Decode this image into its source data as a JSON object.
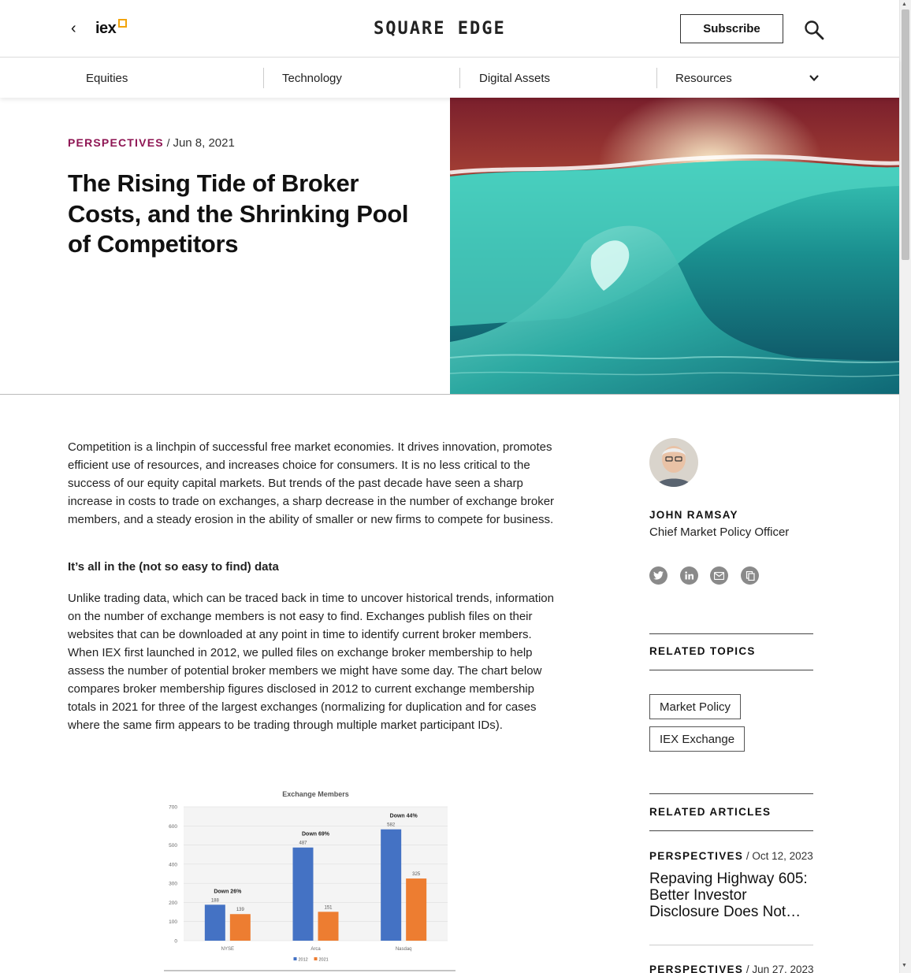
{
  "header": {
    "back_icon": "chevron-left-icon",
    "logo_text": "iex",
    "brand": "SQUARE EDGE",
    "subscribe_label": "Subscribe",
    "search_icon": "search-icon"
  },
  "nav": {
    "items": [
      {
        "label": "Equities"
      },
      {
        "label": "Technology"
      },
      {
        "label": "Digital Assets"
      },
      {
        "label": "Resources"
      }
    ],
    "expand_icon": "chevron-down-icon"
  },
  "article": {
    "category": "PERSPECTIVES",
    "separator": "/",
    "date": "Jun 8, 2021",
    "title": "The Rising Tide of Broker Costs, and the Shrinking Pool of Competitors",
    "paragraph1": "Competition is a linchpin of successful free market economies. It drives innovation, promotes efficient use of resources, and increases choice for consumers. It is no less critical to the success of our equity capital markets. But trends of the past decade have seen a sharp increase in costs to trade on exchanges, a sharp decrease in the number of exchange broker members, and a steady erosion in the ability of smaller or new firms to compete for business.",
    "subheading": "It’s all in the (not so easy to find) data",
    "paragraph2": "Unlike trading data, which can be traced back in time to uncover historical trends, information on the number of exchange members is not easy to find. Exchanges publish files on their websites that can be downloaded at any point in time to identify current broker members. When IEX first launched in 2012, we pulled files on exchange broker membership to help assess the number of potential broker members we might have some day. The chart below compares broker membership figures disclosed in 2012 to current exchange membership totals in 2021 for three of the largest exchanges (normalizing for duplication and for cases where the same firm appears to be trading through multiple market participant IDs)."
  },
  "chart_data": {
    "type": "bar",
    "title": "Exchange Members",
    "categories": [
      "NYSE",
      "Arca",
      "Nasdaq"
    ],
    "series": [
      {
        "name": "2012",
        "values": [
          188,
          487,
          582
        ],
        "color": "#4472c4"
      },
      {
        "name": "2021",
        "values": [
          139,
          151,
          325
        ],
        "color": "#ed7d31"
      }
    ],
    "annotations": [
      "Down 26%",
      "Down 69%",
      "Down 44%"
    ],
    "ylim": [
      0,
      700
    ],
    "yticks": [
      0,
      100,
      200,
      300,
      400,
      500,
      600,
      700
    ],
    "grid": true,
    "legend": "bottom"
  },
  "sidebar": {
    "author_name": "JOHN RAMSAY",
    "author_role": "Chief Market Policy Officer",
    "share_icons": [
      "twitter-icon",
      "linkedin-icon",
      "email-icon",
      "copy-icon"
    ],
    "related_topics_heading": "RELATED TOPICS",
    "topics": [
      "Market Policy",
      "IEX Exchange"
    ],
    "related_articles_heading": "RELATED ARTICLES",
    "related": [
      {
        "category": "PERSPECTIVES",
        "date": "/ Oct 12, 2023",
        "title": "Repaving Highway 605: Better Investor Disclosure Does Not…"
      },
      {
        "category": "PERSPECTIVES",
        "date": "/ Jun 27, 2023",
        "title": ""
      }
    ]
  },
  "colors": {
    "accent": "#8e1553",
    "logo_square": "#f2a40a",
    "bar_2012": "#4472c4",
    "bar_2021": "#ed7d31"
  }
}
